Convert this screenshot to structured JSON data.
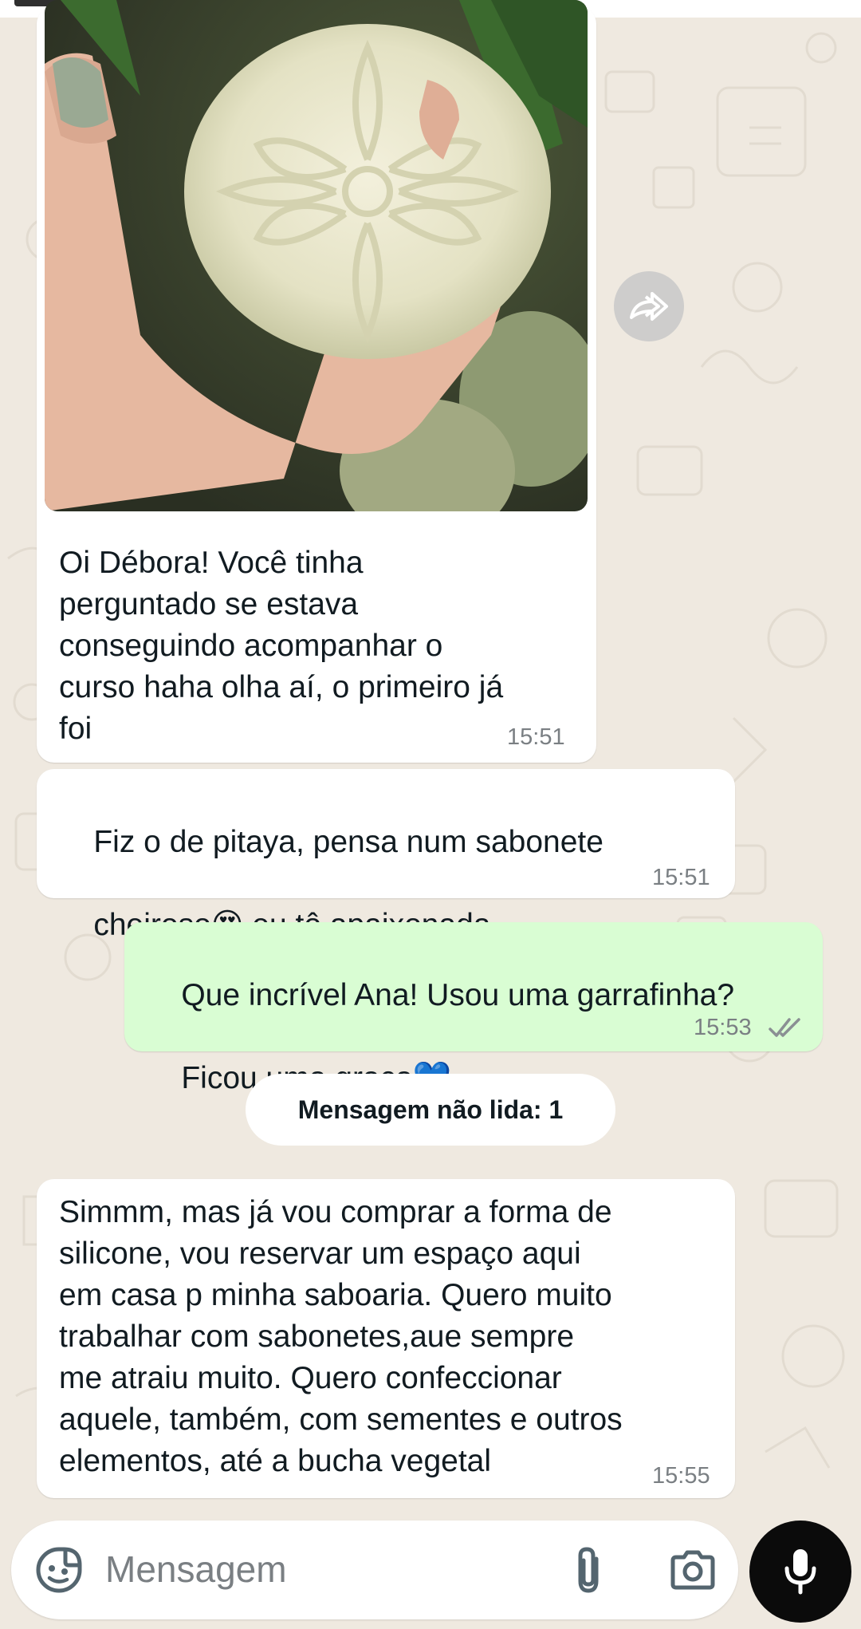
{
  "messages": [
    {
      "id": "m1",
      "direction": "incoming",
      "has_image": true,
      "image_alt": "",
      "text": "Oi Débora! Você tinha\nperguntado se estava\nconseguindo acompanhar o\ncurso haha olha aí, o primeiro já\nfoi",
      "time": "15:51"
    },
    {
      "id": "m2",
      "direction": "incoming",
      "text_line1": "Fiz o de pitaya, pensa num sabonete",
      "text_line2a": "cheiroso",
      "emoji": "😍",
      "text_line2b": " eu tô apaixonada",
      "time": "15:51"
    },
    {
      "id": "m3",
      "direction": "outgoing",
      "text_line1": "Que incrível Ana! Usou uma garrafinha?",
      "text_line2a": "Ficou uma graça",
      "emoji": "💙",
      "time": "15:53",
      "status": "read-double-check"
    },
    {
      "id": "m4",
      "direction": "incoming",
      "text": "Simmm, mas já vou comprar a forma de\nsilicone, vou reservar um espaço aqui\nem casa p minha saboaria. Quero muito\ntrabalhar com sabonetes,aue sempre\nme atraiu muito. Quero confeccionar\naquele, também, com sementes e outros\nelementos, até a bucha vegetal",
      "time": "15:55"
    }
  ],
  "unread_divider": "Mensagem não lida: 1",
  "composer": {
    "placeholder": "Mensagem",
    "icons": [
      "sticker-icon",
      "attach-icon",
      "camera-icon",
      "mic-icon"
    ]
  },
  "colors": {
    "incoming_bubble": "#ffffff",
    "outgoing_bubble": "#d9fdd3",
    "wallpaper": "#efe9e0",
    "read_ticks": "#8a8f93"
  }
}
